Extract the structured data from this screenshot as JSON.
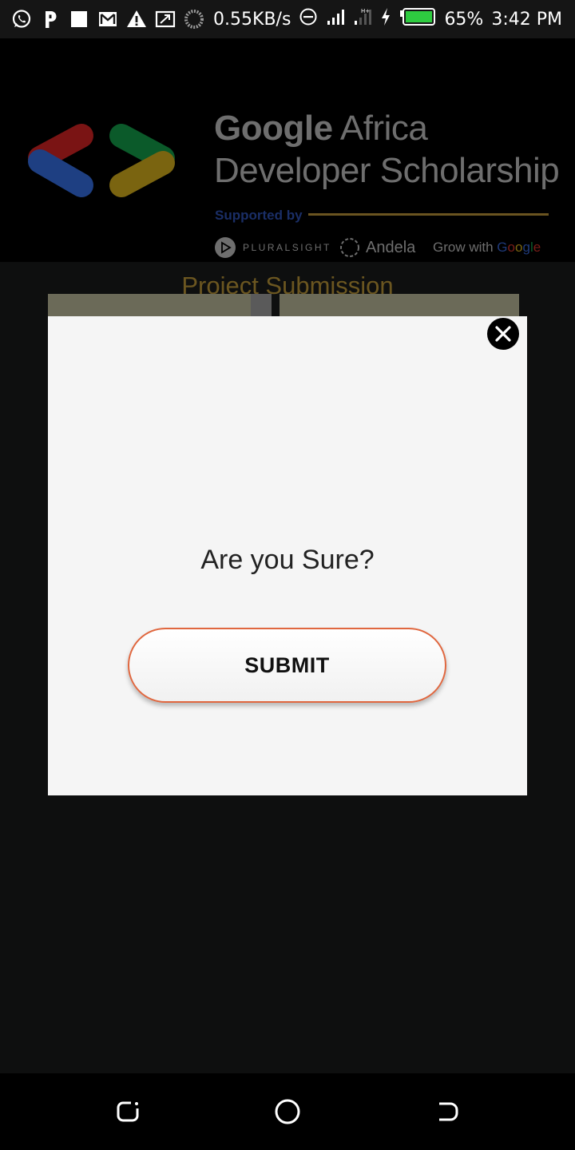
{
  "status_bar": {
    "left_icons": [
      "whatsapp-icon",
      "parking-icon",
      "square-icon",
      "gmail-icon",
      "warning-icon",
      "screen-cast-icon",
      "loading-icon"
    ],
    "net_speed": "0.55KB/s",
    "battery": "65%",
    "time": "3:42 PM"
  },
  "header": {
    "brand_google": "Google",
    "brand_africa": " Africa",
    "brand_line2": "Developer Scholarship",
    "supported_by": "Supported by",
    "sponsor_pluralsight": "PLURALSIGHT",
    "sponsor_andela": "Andela",
    "sponsor_grow_prefix": "Grow with ",
    "page_title": "Project Submission"
  },
  "dialog": {
    "question": "Are you Sure?",
    "submit_label": "SUBMIT"
  },
  "colors": {
    "title": "#6b5620",
    "submit_border": "#e0673f",
    "dialog_bg": "#f5f5f5"
  }
}
